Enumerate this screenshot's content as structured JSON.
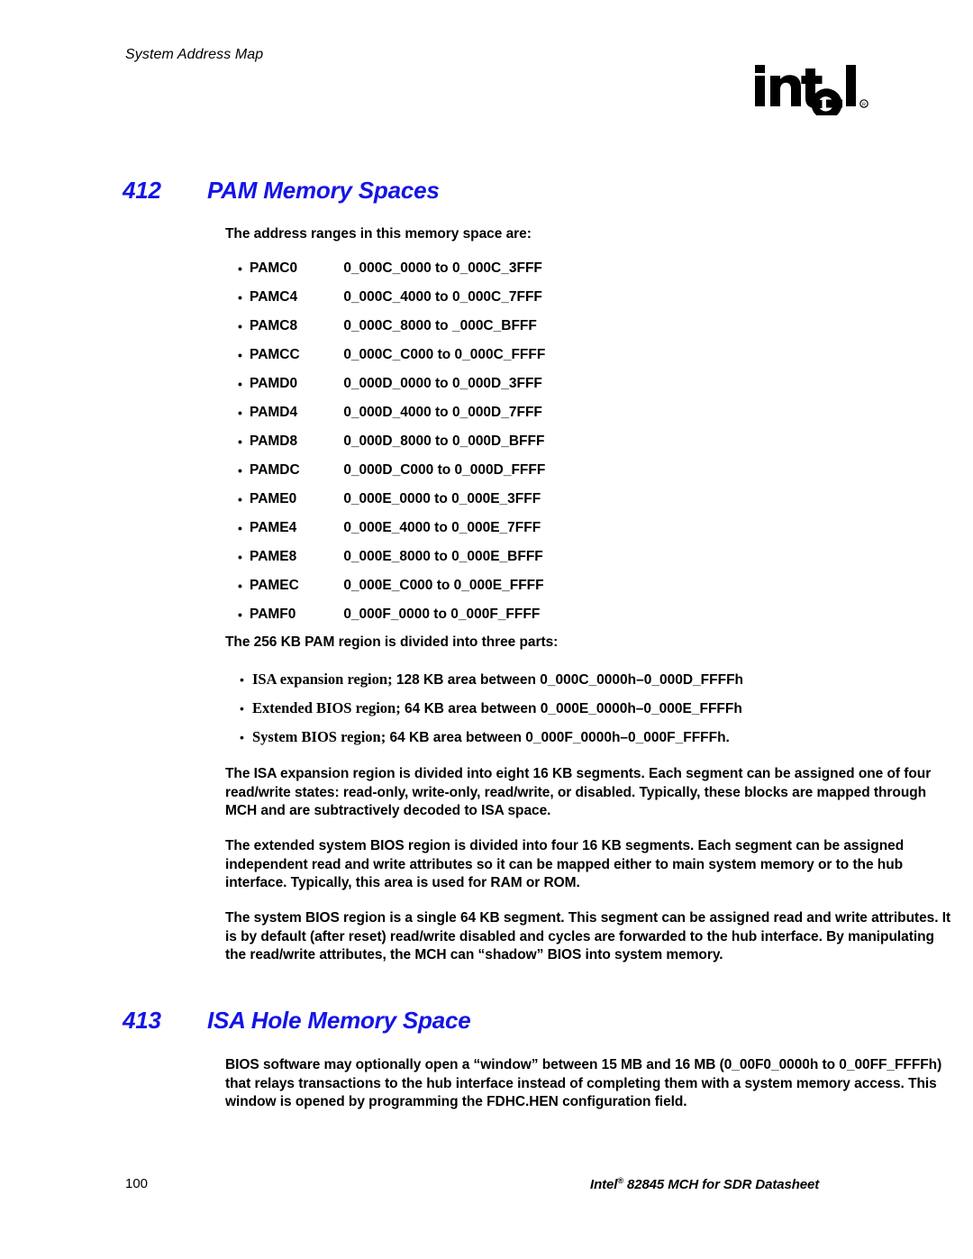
{
  "page": {
    "running_header": "System Address Map",
    "logo_alt": "intel",
    "logo_wordmark": "intel",
    "background_color": "#ffffff",
    "heading_color": "#1414e6",
    "text_color": "#000000"
  },
  "sections": [
    {
      "number": "412",
      "title": "PAM Memory Spaces",
      "intro": "The address ranges in this memory space are:",
      "pam_entries": [
        {
          "name": "PAMC0",
          "range": "0_000C_0000 to 0_000C_3FFF"
        },
        {
          "name": "PAMC4",
          "range": "0_000C_4000 to 0_000C_7FFF"
        },
        {
          "name": "PAMC8",
          "range": "0_000C_8000 to _000C_BFFF"
        },
        {
          "name": "PAMCC",
          "range": "0_000C_C000 to 0_000C_FFFF"
        },
        {
          "name": "PAMD0",
          "range": "0_000D_0000 to 0_000D_3FFF"
        },
        {
          "name": "PAMD4",
          "range": "0_000D_4000 to 0_000D_7FFF"
        },
        {
          "name": "PAMD8",
          "range": "0_000D_8000 to 0_000D_BFFF"
        },
        {
          "name": "PAMDC",
          "range": "0_000D_C000 to 0_000D_FFFF"
        },
        {
          "name": "PAME0",
          "range": "0_000E_0000 to 0_000E_3FFF"
        },
        {
          "name": "PAME4",
          "range": "0_000E_4000 to 0_000E_7FFF"
        },
        {
          "name": "PAME8",
          "range": "0_000E_8000 to 0_000E_BFFF"
        },
        {
          "name": "PAMEC",
          "range": "0_000E_C000 to 0_000E_FFFF"
        },
        {
          "name": "PAMF0",
          "range": " 0_000F_0000 to 0_000F_FFFF"
        }
      ],
      "parts_intro": "The 256 KB PAM region is divided into three parts:",
      "regions": [
        {
          "label": "ISA expansion region;",
          "detail": " 128 KB area between 0_000C_0000h–0_000D_FFFFh"
        },
        {
          "label": "Extended BIOS region;",
          "detail": " 64 KB area between 0_000E_0000h–0_000E_FFFFh"
        },
        {
          "label": "System BIOS region;",
          "detail": " 64 KB area between 0_000F_0000h–0_000F_FFFFh."
        }
      ],
      "paragraphs": [
        "The ISA expansion region is divided into eight 16 KB segments. Each segment can be assigned one of four read/write states: read-only, write-only, read/write, or disabled. Typically, these blocks are mapped through MCH and are subtractively decoded to ISA space.",
        "The extended system BIOS region is divided into four 16 KB segments. Each segment can be assigned independent read and write attributes so it can be mapped either to main system memory or to the hub interface. Typically, this area is used for RAM or ROM.",
        "The system BIOS region is a single 64 KB segment. This segment can be assigned read and write attributes. It is by default (after reset) read/write disabled and cycles are forwarded to the hub interface. By manipulating the read/write attributes, the MCH can “shadow” BIOS into system memory."
      ]
    },
    {
      "number": "413",
      "title": "ISA Hole Memory Space",
      "paragraphs": [
        "BIOS software may optionally open a “window” between 15 MB and 16 MB (0_00F0_0000h to 0_00FF_FFFFh) that relays transactions to the hub interface instead of completing them with a system memory access. This window is opened by programming the FDHC.HEN configuration field."
      ]
    }
  ],
  "bullet_glyph": "•",
  "footer": {
    "page_number": "100",
    "doc_title_prefix": "Intel",
    "doc_title_registered": "®",
    "doc_title_suffix": " 82845 MCH for SDR Datasheet"
  }
}
